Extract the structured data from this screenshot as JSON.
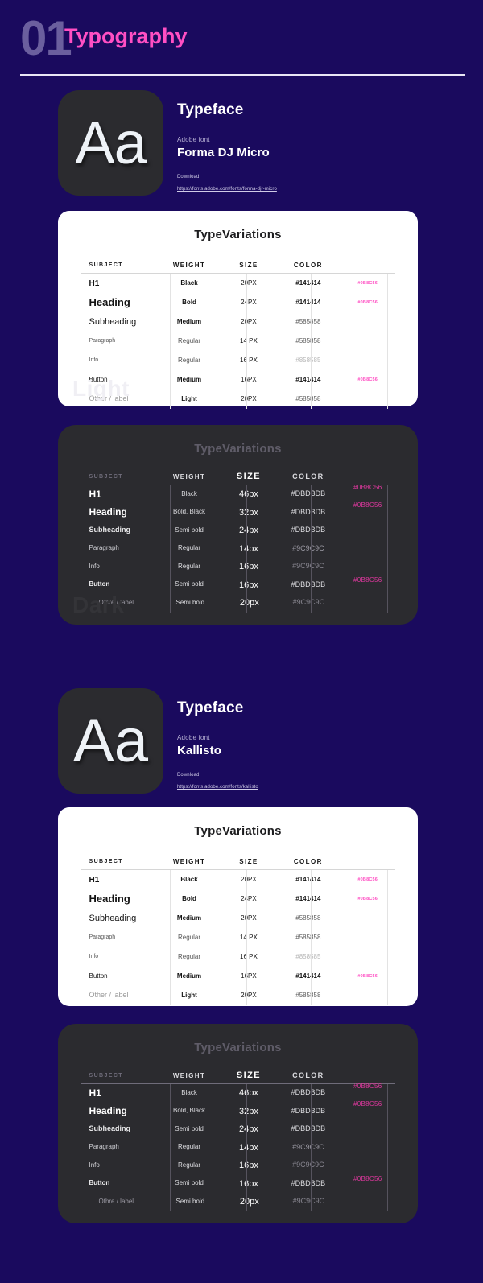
{
  "header": {
    "number": "01",
    "title": "Typography"
  },
  "accent_colors": {
    "pink": "#ff4fc3",
    "background": "#1a0a5e",
    "dark_card": "#2b2b2f",
    "light_card": "#ffffff"
  },
  "typefaces": [
    {
      "glyph": "Aa",
      "heading": "Typeface",
      "source_label": "Adobe font",
      "name": "Forma DJ Micro",
      "download_label": "Download",
      "download_url": "https://fonts.adobe.com/fonts/forma-djr-micro"
    },
    {
      "glyph": "Aa",
      "heading": "Typeface",
      "source_label": "Adobe font",
      "name": "Kallisto",
      "download_label": "Download",
      "download_url": "https://fonts.adobe.com/fonts/kallisto"
    }
  ],
  "table_columns": [
    "SUBJECT",
    "WEIGHT",
    "SIZE",
    "COLOR"
  ],
  "light_table": {
    "title": "TypeVariations",
    "watermark": "Light",
    "rows": [
      {
        "subject": "H1",
        "weight": "Black",
        "size": "20PX",
        "color": "#141414",
        "accent": "#0B8C56"
      },
      {
        "subject": "Heading",
        "weight": "Bold",
        "size": "24PX",
        "color": "#141414",
        "accent": "#0B8C56"
      },
      {
        "subject": "Subheading",
        "weight": "Medium",
        "size": "20PX",
        "color": "#585858",
        "accent": ""
      },
      {
        "subject": "Paragraph",
        "weight": "Regular",
        "size": "14 PX",
        "color": "#585858",
        "accent": ""
      },
      {
        "subject": "Info",
        "weight": "Regular",
        "size": "16 PX",
        "color": "#858585",
        "accent": ""
      },
      {
        "subject": "Button",
        "weight": "Medium",
        "size": "16PX",
        "color": "#141414",
        "accent": "#0B8C56"
      },
      {
        "subject": "Other / label",
        "weight": "Light",
        "size": "20PX",
        "color": "#585858",
        "accent": ""
      }
    ]
  },
  "dark_table": {
    "title": "TypeVariations",
    "watermark": "Dark",
    "rows": [
      {
        "subject": "H1",
        "weight": "Black",
        "size": "46px",
        "color": "#DBDBDB",
        "accent": "#0B8C56"
      },
      {
        "subject": "Heading",
        "weight": "Bold, Black",
        "size": "32px",
        "color": "#DBDBDB",
        "accent": "#0B8C56"
      },
      {
        "subject": "Subheading",
        "weight": "Semi bold",
        "size": "24px",
        "color": "#DBDBDB",
        "accent": ""
      },
      {
        "subject": "Paragraph",
        "weight": "Regular",
        "size": "14px",
        "color": "#9C9C9C",
        "accent": ""
      },
      {
        "subject": "Info",
        "weight": "Regular",
        "size": "16px",
        "color": "#9C9C9C",
        "accent": ""
      },
      {
        "subject": "Button",
        "weight": "Semi bold",
        "size": "16px",
        "color": "#DBDBDB",
        "accent": "#0B8C56"
      },
      {
        "subject": "Othre / label",
        "weight": "Semi bold",
        "size": "20px",
        "color": "#9C9C9C",
        "accent": ""
      }
    ]
  }
}
